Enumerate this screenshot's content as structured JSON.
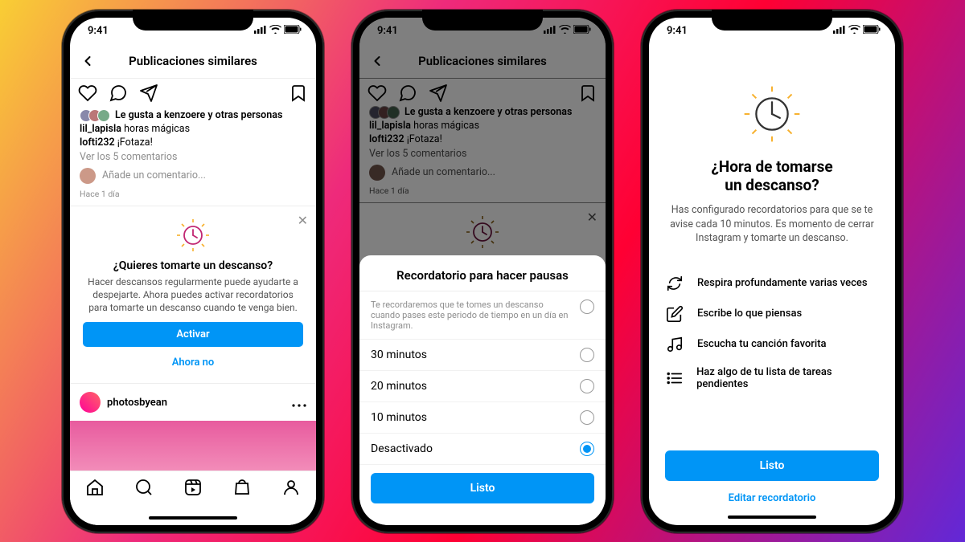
{
  "status": {
    "time": "9:41"
  },
  "header": {
    "title": "Publicaciones similares"
  },
  "post": {
    "likes_text": "Le gusta a kenzoere y otras personas",
    "caption1_user": "lil_lapisla",
    "caption1_text": "horas mágicas",
    "caption2_user": "lofti232",
    "caption2_text": "¡Fotaza!",
    "view_comments": "Ver los 5 comentarios",
    "add_comment_placeholder": "Añade un comentario...",
    "timestamp": "Hace 1 día"
  },
  "prompt": {
    "title": "¿Quieres tomarte un descanso?",
    "body": "Hacer descansos regularmente puede ayudarte a despejarte. Ahora puedes activar recordatorios para tomarte un descanso cuando te venga bien.",
    "activate": "Activar",
    "not_now": "Ahora no"
  },
  "next_post": {
    "username": "photosbyean"
  },
  "sheet": {
    "title": "Recordatorio para hacer pausas",
    "desc": "Te recordaremos que te tomes un descanso cuando pases este periodo de tiempo en un día en Instagram.",
    "options": [
      "30 minutos",
      "20 minutos",
      "10 minutos",
      "Desactivado"
    ],
    "selected_index": 3,
    "done": "Listo"
  },
  "break": {
    "title_line1": "¿Hora de tomarse",
    "title_line2": "un descanso?",
    "desc": "Has configurado recordatorios para que se te avise cada 10 minutos. Es momento de cerrar Instagram y tomarte un descanso.",
    "tips": [
      "Respira profundamente varias veces",
      "Escribe lo que piensas",
      "Escucha tu canción favorita",
      "Haz algo de tu lista de tareas pendientes"
    ],
    "done": "Listo",
    "edit": "Editar recordatorio"
  }
}
